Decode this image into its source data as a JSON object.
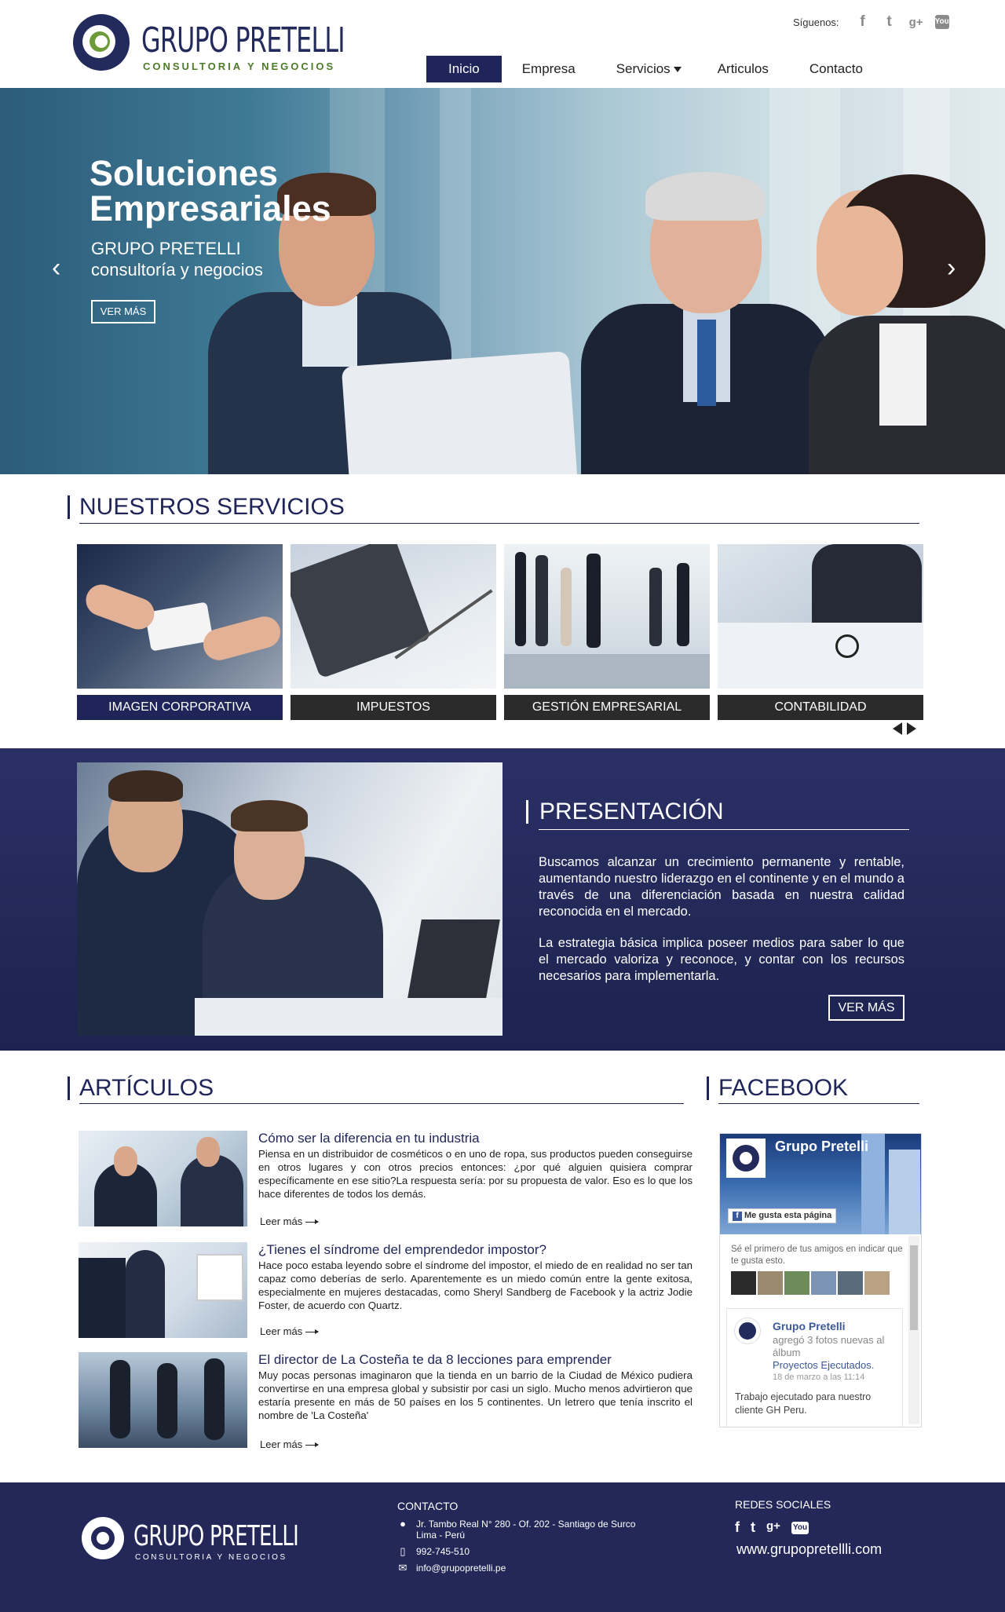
{
  "header": {
    "logo_name": "GRUPO PRETELLI",
    "logo_tagline": "CONSULTORIA Y NEGOCIOS",
    "social_label": "Síguenos:",
    "social_icons": [
      "f",
      "t",
      "g+",
      "You"
    ],
    "nav": [
      "Inicio",
      "Empresa",
      "Servicios",
      "Articulos",
      "Contacto"
    ]
  },
  "hero": {
    "title": "Soluciones Empresariales",
    "sub1": "GRUPO PRETELLI",
    "sub2": "consultoría y negocios",
    "button": "VER MÁS",
    "prev": "‹",
    "next": "›"
  },
  "services": {
    "title": "NUESTROS SERVICIOS",
    "items": [
      "IMAGEN CORPORATIVA",
      "IMPUESTOS",
      "GESTIÓN EMPRESARIAL",
      "CONTABILIDAD"
    ]
  },
  "presentation": {
    "title": "PRESENTACIÓN",
    "p1": "Buscamos alcanzar un crecimiento permanente y rentable, aumentando nuestro liderazgo en el continente y en el mundo a través de una diferenciación basada en nuestra calidad reconocida en el mercado.",
    "p2": "La estrategia básica implica poseer medios para saber lo que el mercado valoriza y reconoce, y contar con los recursos necesarios para implementarla.",
    "button": "VER MÁS"
  },
  "articles": {
    "title": "ARTÍCULOS",
    "more": "Leer más",
    "items": [
      {
        "title": "Cómo ser la diferencia en tu industria",
        "desc": "Piensa en un distribuidor de cosméticos o en uno de ropa, sus productos pueden conseguirse en otros lugares y con otros precios entonces: ¿por qué alguien quisiera comprar específicamente en ese sitio?La respuesta sería: por su propuesta de valor. Eso es lo que los hace diferentes de todos los demás."
      },
      {
        "title": "¿Tienes el síndrome del emprendedor impostor?",
        "desc": "Hace poco estaba leyendo sobre el síndrome del impostor, el miedo de en realidad no ser tan capaz como deberías de serlo. Aparentemente es un miedo común entre la gente exitosa, especialmente en mujeres destacadas, como Sheryl Sandberg de Facebook y la actriz Jodie Foster, de acuerdo con Quartz."
      },
      {
        "title": "El director de La Costeña te da 8 lecciones para emprender",
        "desc": "Muy pocas personas imaginaron que la tienda en un barrio de la Ciudad de México pudiera convertirse en una empresa global y subsistir por casi un siglo. Mucho menos advirtieron que estaría presente en más de 50 países en los 5 continentes. Un letrero que tenía inscrito el nombre de 'La Costeña'"
      }
    ]
  },
  "facebook": {
    "title": "FACEBOOK",
    "page_name": "Grupo Pretelli",
    "like": "Me gusta esta página",
    "friends": "Sé el primero de tus amigos en indicar que te gusta esto.",
    "post_name": "Grupo Pretelli",
    "post_action": "agregó 3 fotos nuevas al álbum",
    "post_album": "Proyectos Ejecutados.",
    "post_date": "18 de marzo a las 11:14",
    "post_text": "Trabajo ejecutado para nuestro cliente GH Peru."
  },
  "footer": {
    "logo_name": "GRUPO PRETELLI",
    "logo_tagline": "CONSULTORIA Y NEGOCIOS",
    "contact_title": "CONTACTO",
    "address1": "Jr. Tambo Real N° 280 - Of. 202 - Santiago de Surco",
    "address2": "Lima - Perú",
    "phone": "992-745-510",
    "email": "info@grupopretelli.pe",
    "social_title": "REDES SOCIALES",
    "social_icons": [
      "f",
      "t",
      "g+",
      "You"
    ],
    "web": "www.grupopretellli.com"
  }
}
